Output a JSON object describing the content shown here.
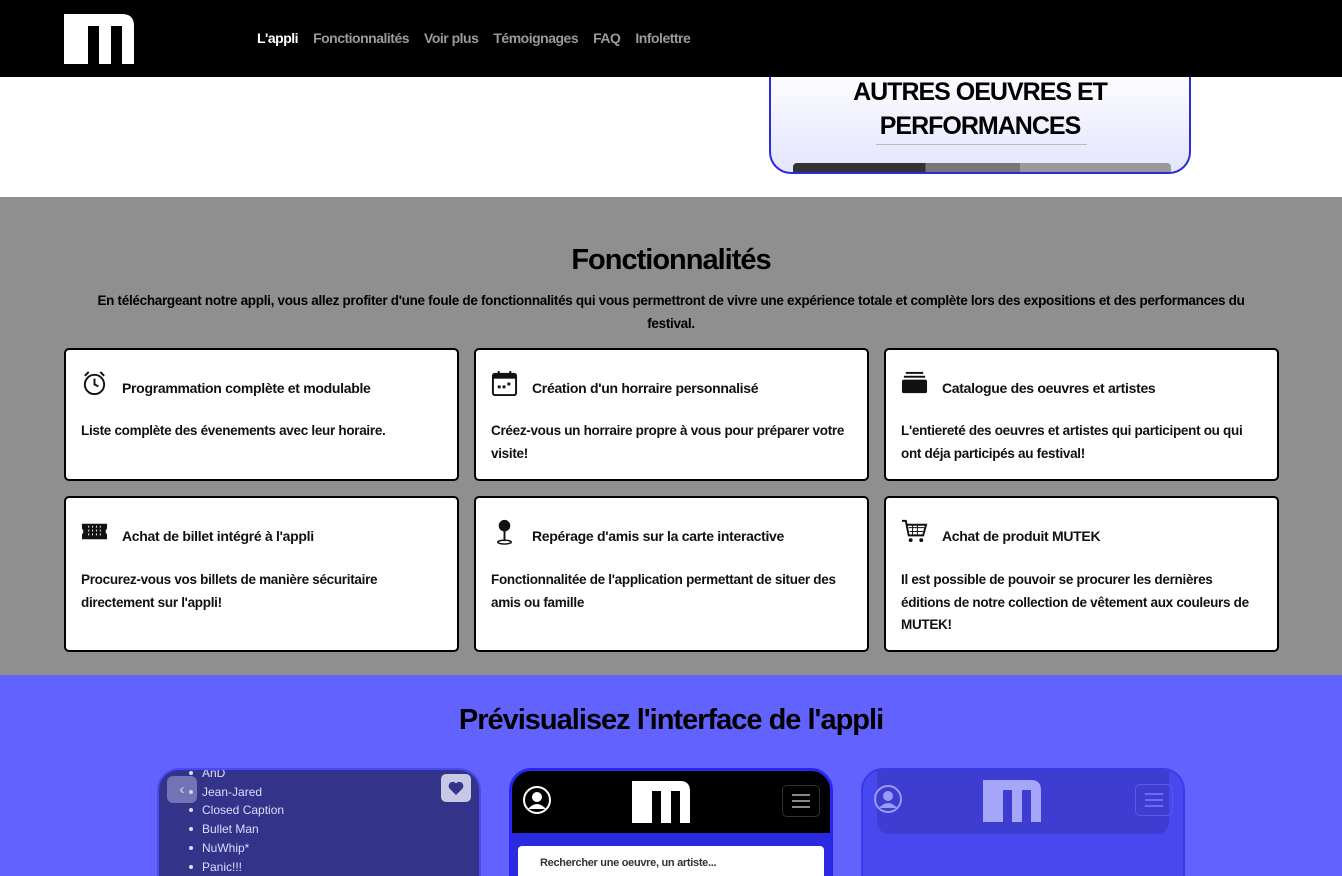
{
  "nav": {
    "logo": "mutek-logo",
    "links": [
      "L'appli",
      "Fonctionnalités",
      "Voir plus",
      "Témoignages",
      "FAQ",
      "Infolettre"
    ],
    "active": "L'appli"
  },
  "oeuvres_card": {
    "title_line1": "AUTRES OEUVRES ET",
    "title_line2": "PERFORMANCES"
  },
  "features": {
    "title": "Fonctionnalités",
    "description": "En téléchargeant notre appli, vous allez profiter d'une foule de fonctionnalités qui vous permettront de vivre une expérience totale et complète lors des expositions et des performances du festival.",
    "cards": [
      {
        "icon": "alarm-clock-icon",
        "title": "Programmation complète et modulable",
        "text": "Liste complète des évenements avec leur horaire."
      },
      {
        "icon": "calendar-icon",
        "title": "Création d'un horraire personnalisé",
        "text": "Créez-vous un horraire propre à vous pour préparer votre visite!"
      },
      {
        "icon": "collection-icon",
        "title": "Catalogue des oeuvres et artistes",
        "text": "L'entiereté des oeuvres et artistes qui participent ou qui ont déja participés au festival!"
      },
      {
        "icon": "ticket-icon",
        "title": "Achat de billet intégré à l'appli",
        "text": "Procurez-vous vos billets de manière sécuritaire directement sur l'appli!"
      },
      {
        "icon": "map-pin-icon",
        "title": "Repérage d'amis sur la carte interactive",
        "text": "Fonctionnalitée de l'application permettant de situer des amis ou famille"
      },
      {
        "icon": "shopping-cart-icon",
        "title": "Achat de produit MUTEK",
        "text": "Il est possible de pouvoir se procurer les dernières éditions de notre collection de vêtement aux couleurs de MUTEK!"
      }
    ]
  },
  "preview": {
    "title": "Prévisualisez l'interface de l'appli",
    "phone1_list": [
      "AnD",
      "Jean-Jared",
      "Closed Caption",
      "Bullet Man",
      "NuWhip*",
      "Panic!!!"
    ],
    "phone2_search_placeholder": "Rechercher une oeuvre, un artiste..."
  },
  "colors": {
    "nav_bg": "#000000",
    "features_bg": "#8f8f8f",
    "preview_bg": "#6262ff",
    "accent_blue": "#2b2bdd"
  }
}
